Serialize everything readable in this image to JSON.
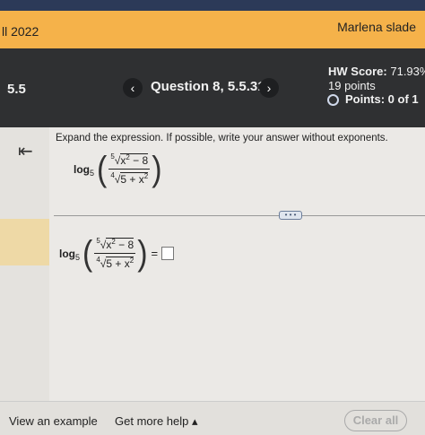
{
  "header": {
    "course": "ll 2022",
    "user": "Marlena slade"
  },
  "question_bar": {
    "section": "5.5",
    "prev_icon": "chevron-left-icon",
    "prev_glyph": "‹",
    "title": "Question 8, 5.5.31",
    "next_icon": "chevron-right-icon",
    "next_glyph": "›",
    "hw_score_label": "HW Score:",
    "hw_score_value": "71.93%,",
    "hw_points": "19 points",
    "points_label": "Points: 0 of 1"
  },
  "problem": {
    "collapse_icon": "collapse-left-icon",
    "collapse_glyph": "⇤",
    "prompt": "Expand the expression. If possible, write your answer without exponents.",
    "expression": {
      "log": "log",
      "base": "5",
      "num_index": "5",
      "num_radicand_a": "x",
      "num_radicand_exp": "2",
      "num_radicand_b": " − 8",
      "den_index": "4",
      "den_radicand_a": "5 + x",
      "den_radicand_exp": "2",
      "equals": "="
    },
    "more_glyph": "• • •"
  },
  "footer": {
    "view_example": "View an example",
    "get_help": "Get more help ▴",
    "clear_all": "Clear all"
  }
}
